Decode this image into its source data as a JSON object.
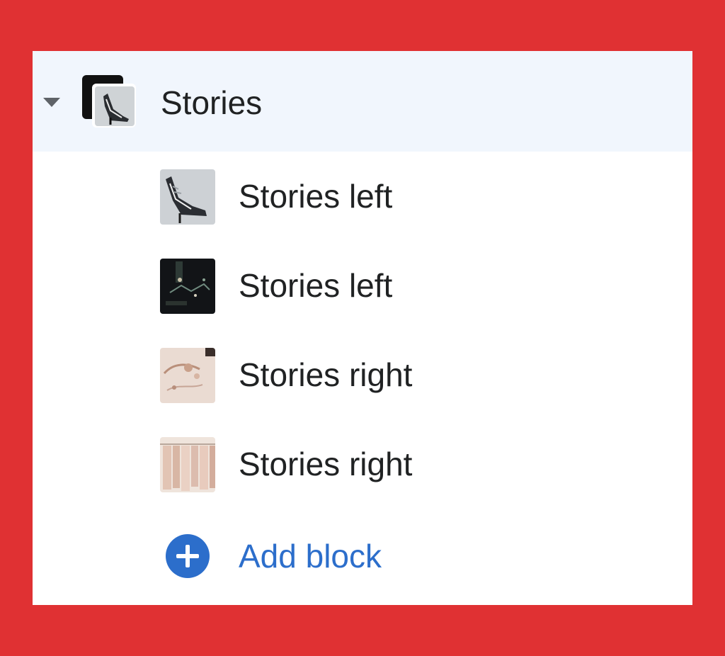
{
  "section": {
    "title": "Stories",
    "expanded": true,
    "icon": "stories-section-icon",
    "background": "#f1f6fd"
  },
  "blocks": [
    {
      "label": "Stories left",
      "thumbnail": "heels-photo-thumbnail"
    },
    {
      "label": "Stories left",
      "thumbnail": "dark-photo-thumbnail"
    },
    {
      "label": "Stories right",
      "thumbnail": "jewelry-photo-thumbnail"
    },
    {
      "label": "Stories right",
      "thumbnail": "clothes-rack-thumbnail"
    }
  ],
  "add_block": {
    "label": "Add block",
    "icon": "plus-circle-icon",
    "color": "#2c6ecb"
  },
  "colors": {
    "frame": "#e03133",
    "text": "#202223",
    "accent": "#2c6ecb"
  }
}
